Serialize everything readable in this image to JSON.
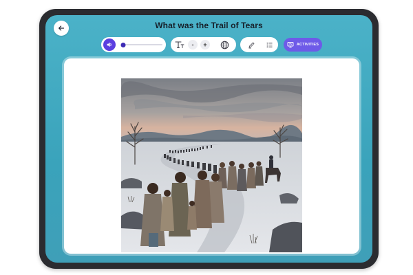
{
  "lesson": {
    "title": "What was the Trail of Tears"
  },
  "toolbar": {
    "audio_progress": 0.05,
    "decrease_label": "-",
    "increase_label": "+",
    "activities_label": "ACTIVITIES"
  },
  "icons": {
    "back": "arrow-left-icon",
    "audio": "speaker-icon",
    "font": "text-size-icon",
    "language": "globe-icon",
    "highlight": "pencil-icon",
    "list": "list-icon",
    "activities": "presentation-icon"
  },
  "colors": {
    "screen_background": "#42a9c0",
    "accent": "#5b3fe0",
    "activities_button": "#6e5ae8",
    "device_frame": "#2b2c30"
  }
}
